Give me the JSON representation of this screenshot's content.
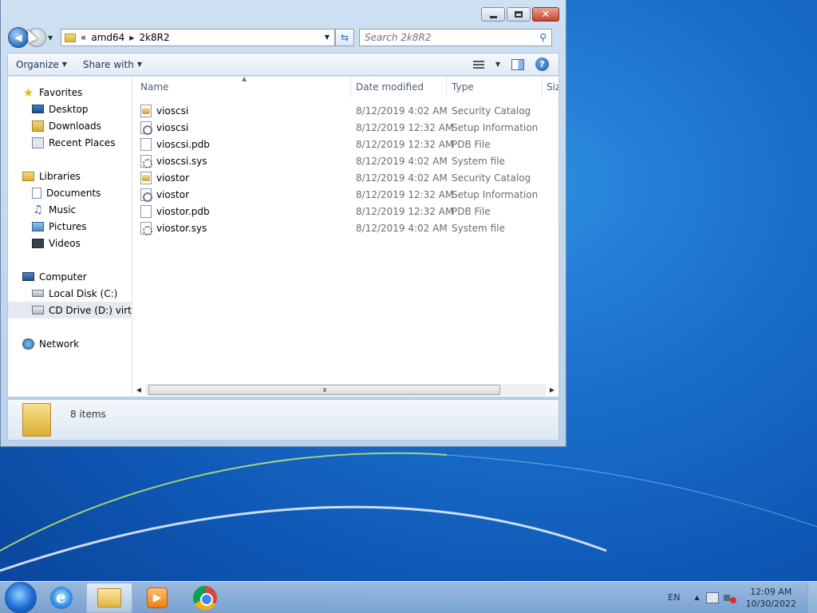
{
  "window": {
    "caption": {
      "minimize": "",
      "maximize": "",
      "close": "✕"
    },
    "address": {
      "overflow": "«",
      "segments": [
        "amd64",
        "2k8R2"
      ]
    },
    "search": {
      "placeholder": "Search 2k8R2"
    }
  },
  "toolbar": {
    "organize": "Organize",
    "share_with": "Share with"
  },
  "nav": {
    "favorites": {
      "label": "Favorites",
      "items": [
        "Desktop",
        "Downloads",
        "Recent Places"
      ]
    },
    "libraries": {
      "label": "Libraries",
      "items": [
        "Documents",
        "Music",
        "Pictures",
        "Videos"
      ]
    },
    "computer": {
      "label": "Computer",
      "items": [
        "Local Disk (C:)",
        "CD Drive (D:) virtio-w"
      ]
    },
    "network": {
      "label": "Network"
    }
  },
  "columns": {
    "name": "Name",
    "date": "Date modified",
    "type": "Type",
    "size": "Size"
  },
  "files": [
    {
      "name": "vioscsi",
      "date": "8/12/2019 4:02 AM",
      "type": "Security Catalog",
      "icon": "catalog-file-icon"
    },
    {
      "name": "vioscsi",
      "date": "8/12/2019 12:32 AM",
      "type": "Setup Information",
      "icon": "setup-info-icon"
    },
    {
      "name": "vioscsi.pdb",
      "date": "8/12/2019 12:32 AM",
      "type": "PDB File",
      "icon": "blank-file-icon"
    },
    {
      "name": "vioscsi.sys",
      "date": "8/12/2019 4:02 AM",
      "type": "System file",
      "icon": "system-file-icon"
    },
    {
      "name": "viostor",
      "date": "8/12/2019 4:02 AM",
      "type": "Security Catalog",
      "icon": "catalog-file-icon"
    },
    {
      "name": "viostor",
      "date": "8/12/2019 12:32 AM",
      "type": "Setup Information",
      "icon": "setup-info-icon"
    },
    {
      "name": "viostor.pdb",
      "date": "8/12/2019 12:32 AM",
      "type": "PDB File",
      "icon": "blank-file-icon"
    },
    {
      "name": "viostor.sys",
      "date": "8/12/2019 4:02 AM",
      "type": "System file",
      "icon": "system-file-icon"
    }
  ],
  "details": {
    "count": "8 items"
  },
  "scrollbar": {
    "grip": "III"
  },
  "taskbar": {
    "language": "EN",
    "time": "12:09 AM",
    "date": "10/30/2022"
  }
}
